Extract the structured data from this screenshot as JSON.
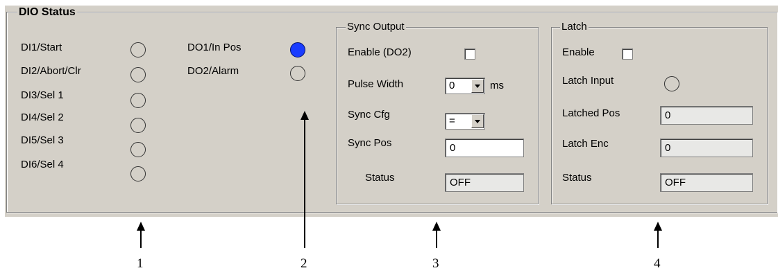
{
  "dio_status": {
    "title": "DIO Status",
    "inputs": [
      {
        "label": "DI1/Start",
        "on": false
      },
      {
        "label": "DI2/Abort/Clr",
        "on": false
      },
      {
        "label": "DI3/Sel 1",
        "on": false
      },
      {
        "label": "DI4/Sel 2",
        "on": false
      },
      {
        "label": "DI5/Sel 3",
        "on": false
      },
      {
        "label": "DI6/Sel 4",
        "on": false
      }
    ],
    "outputs": [
      {
        "label": "DO1/In Pos",
        "on": true
      },
      {
        "label": "DO2/Alarm",
        "on": false
      }
    ],
    "led_on_color": "#1a3cff"
  },
  "sync_output": {
    "title": "Sync Output",
    "enable_label": "Enable (DO2)",
    "enable_checked": false,
    "pulse_width_label": "Pulse Width",
    "pulse_width_value": "0",
    "pulse_width_unit": "ms",
    "sync_cfg_label": "Sync Cfg",
    "sync_cfg_value": "=",
    "sync_pos_label": "Sync Pos",
    "sync_pos_value": "0",
    "status_label": "Status",
    "status_value": "OFF"
  },
  "latch": {
    "title": "Latch",
    "enable_label": "Enable",
    "enable_checked": false,
    "latch_input_label": "Latch Input",
    "latch_input_on": false,
    "latched_pos_label": "Latched Pos",
    "latched_pos_value": "0",
    "latch_enc_label": "Latch Enc",
    "latch_enc_value": "0",
    "status_label": "Status",
    "status_value": "OFF"
  },
  "callouts": [
    "1",
    "2",
    "3",
    "4"
  ]
}
